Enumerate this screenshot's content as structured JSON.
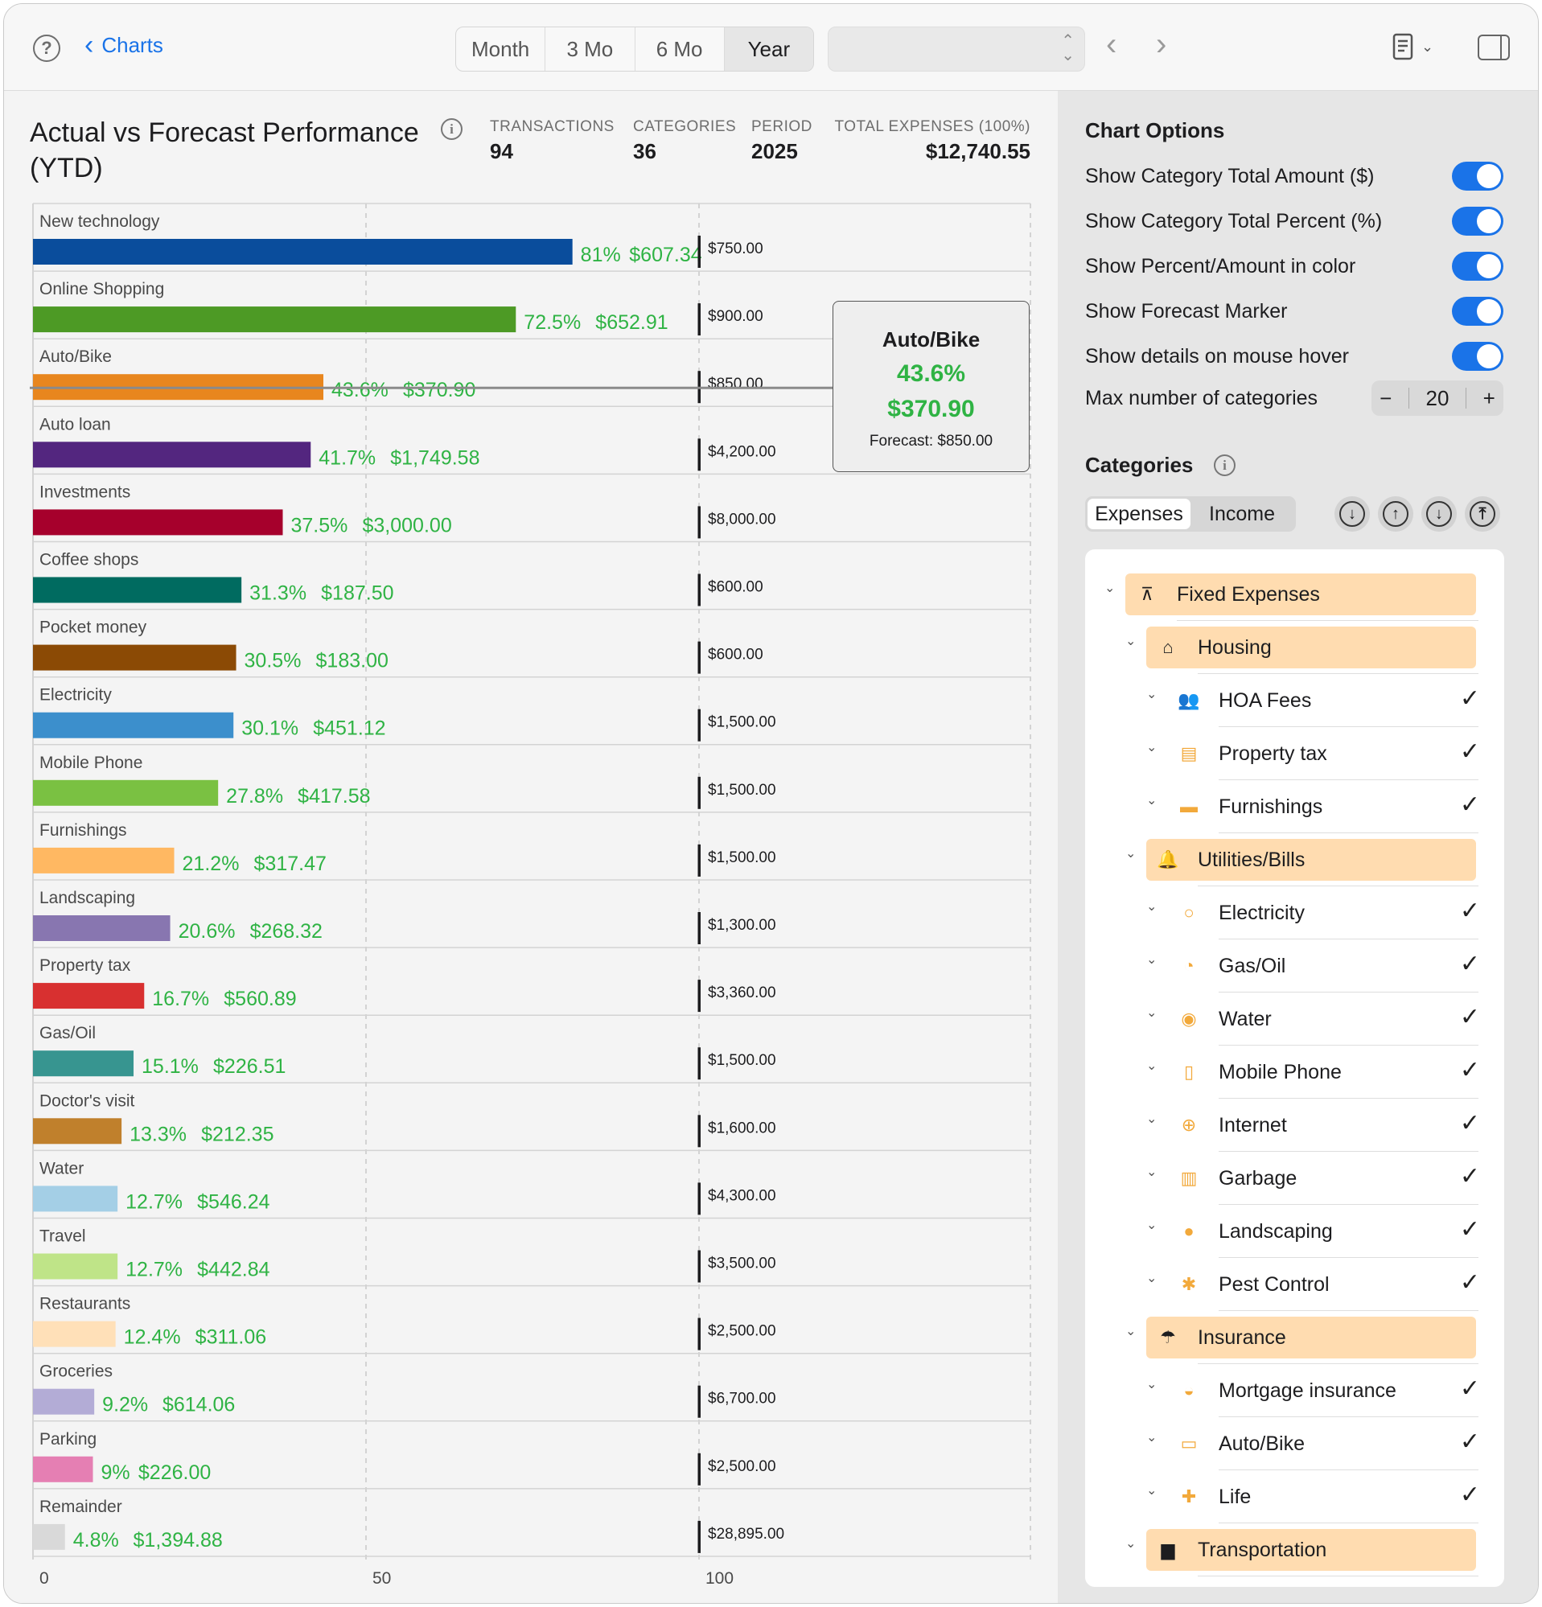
{
  "toolbar": {
    "help_icon": "question-circle-icon",
    "back_label": "Charts",
    "periods": [
      "Month",
      "3 Mo",
      "6 Mo",
      "Year"
    ],
    "active_period": "Year",
    "popup_value": ""
  },
  "header": {
    "title": "Actual vs Forecast Performance (YTD)",
    "stats": [
      {
        "label": "TRANSACTIONS",
        "value": "94"
      },
      {
        "label": "CATEGORIES",
        "value": "36"
      },
      {
        "label": "PERIOD",
        "value": "2025"
      },
      {
        "label": "TOTAL EXPENSES (100%)",
        "value": "$12,740.55"
      }
    ]
  },
  "tooltip": {
    "name": "Auto/Bike",
    "percent": "43.6%",
    "amount": "$370.90",
    "forecast": "Forecast: $850.00"
  },
  "chart_data": {
    "type": "bar",
    "orientation": "horizontal",
    "x_ticks": [
      "0",
      "50",
      "100"
    ],
    "xlim": [
      0,
      150
    ],
    "grid": true,
    "categories": [
      "New technology",
      "Online Shopping",
      "Auto/Bike",
      "Auto loan",
      "Investments",
      "Coffee shops",
      "Pocket money",
      "Electricity",
      "Mobile Phone",
      "Furnishings",
      "Landscaping",
      "Property tax",
      "Gas/Oil",
      "Doctor's visit",
      "Water",
      "Travel",
      "Restaurants",
      "Groceries",
      "Parking",
      "Remainder"
    ],
    "percent": [
      81,
      72.5,
      43.6,
      41.7,
      37.5,
      31.3,
      30.5,
      30.1,
      27.8,
      21.2,
      20.6,
      16.7,
      15.1,
      13.3,
      12.7,
      12.7,
      12.4,
      9.2,
      9,
      4.8
    ],
    "percent_labels": [
      "81%",
      "72.5%",
      "43.6%",
      "41.7%",
      "37.5%",
      "31.3%",
      "30.5%",
      "30.1%",
      "27.8%",
      "21.2%",
      "20.6%",
      "16.7%",
      "15.1%",
      "13.3%",
      "12.7%",
      "12.7%",
      "12.4%",
      "9.2%",
      "9%",
      "4.8%"
    ],
    "actual": [
      "$607.34",
      "$652.91",
      "$370.90",
      "$1,749.58",
      "$3,000.00",
      "$187.50",
      "$183.00",
      "$451.12",
      "$417.58",
      "$317.47",
      "$268.32",
      "$560.89",
      "$226.51",
      "$212.35",
      "$546.24",
      "$442.84",
      "$311.06",
      "$614.06",
      "$226.00",
      "$1,394.88"
    ],
    "forecast": [
      "$750.00",
      "$900.00",
      "$850.00",
      "$4,200.00",
      "$8,000.00",
      "$600.00",
      "$600.00",
      "$1,500.00",
      "$1,500.00",
      "$1,500.00",
      "$1,300.00",
      "$3,360.00",
      "$1,500.00",
      "$1,600.00",
      "$4,300.00",
      "$3,500.00",
      "$2,500.00",
      "$6,700.00",
      "$2,500.00",
      "$28,895.00"
    ],
    "forecast_marker_at": 100,
    "colors": [
      "#0a4d9c",
      "#4d9a25",
      "#e8861e",
      "#53267f",
      "#a6002c",
      "#006b60",
      "#8b4a05",
      "#3c8fcc",
      "#7ac142",
      "#ffb862",
      "#8876b0",
      "#d83030",
      "#379590",
      "#c0802c",
      "#a4cfe6",
      "#bfe488",
      "#ffe0b8",
      "#b3acd6",
      "#e57fb3",
      "#d9d9d9"
    ],
    "value_color": "#2fb344",
    "highlighted": "Auto/Bike"
  },
  "options": {
    "title": "Chart Options",
    "toggles": [
      {
        "label": "Show Category Total Amount ($)",
        "on": true
      },
      {
        "label": "Show Category Total Percent (%)",
        "on": true
      },
      {
        "label": "Show Percent/Amount in color",
        "on": true
      },
      {
        "label": "Show Forecast Marker",
        "on": true
      },
      {
        "label": "Show details on mouse hover",
        "on": true
      }
    ],
    "max_label": "Max number of categories",
    "max_value": "20",
    "minus": "−",
    "plus": "+"
  },
  "categories_panel": {
    "title": "Categories",
    "tabs": [
      "Expenses",
      "Income"
    ],
    "active_tab": "Expenses",
    "sort_icons": [
      "sort-down-icon",
      "sort-up-icon",
      "arrow-down-icon",
      "arrow-top-icon"
    ],
    "tree": [
      {
        "level": 0,
        "label": "Fixed Expenses",
        "group": true,
        "icon": "pin-icon",
        "glyph": "⊼"
      },
      {
        "level": 1,
        "label": "Housing",
        "group": true,
        "icon": "house-icon",
        "glyph": "⌂"
      },
      {
        "level": 2,
        "label": "HOA Fees",
        "icon": "people-icon",
        "glyph": "👥"
      },
      {
        "level": 2,
        "label": "Property tax",
        "icon": "clipboard-icon",
        "glyph": "▤"
      },
      {
        "level": 2,
        "label": "Furnishings",
        "icon": "sofa-icon",
        "glyph": "▬"
      },
      {
        "level": 1,
        "label": "Utilities/Bills",
        "group": true,
        "icon": "bell-icon",
        "glyph": "🔔"
      },
      {
        "level": 2,
        "label": "Electricity",
        "icon": "lightbulb-icon",
        "glyph": "○"
      },
      {
        "level": 2,
        "label": "Gas/Oil",
        "icon": "gauge-icon",
        "glyph": "◔"
      },
      {
        "level": 2,
        "label": "Water",
        "icon": "drop-icon",
        "glyph": "◉"
      },
      {
        "level": 2,
        "label": "Mobile Phone",
        "icon": "phone-icon",
        "glyph": "▯"
      },
      {
        "level": 2,
        "label": "Internet",
        "icon": "globe-icon",
        "glyph": "⊕"
      },
      {
        "level": 2,
        "label": "Garbage",
        "icon": "trash-icon",
        "glyph": "▥"
      },
      {
        "level": 2,
        "label": "Landscaping",
        "icon": "tree-icon",
        "glyph": "●"
      },
      {
        "level": 2,
        "label": "Pest Control",
        "icon": "bug-icon",
        "glyph": "✱"
      },
      {
        "level": 1,
        "label": "Insurance",
        "group": true,
        "icon": "umbrella-icon",
        "glyph": "☂"
      },
      {
        "level": 2,
        "label": "Mortgage insurance",
        "icon": "gauge-icon",
        "glyph": "◒"
      },
      {
        "level": 2,
        "label": "Auto/Bike",
        "icon": "car-icon",
        "glyph": "▭"
      },
      {
        "level": 2,
        "label": "Life",
        "icon": "cross-icon",
        "glyph": "✚"
      },
      {
        "level": 1,
        "label": "Transportation",
        "group": true,
        "icon": "truck-icon",
        "glyph": "▆"
      }
    ],
    "check_glyph": "✓"
  }
}
